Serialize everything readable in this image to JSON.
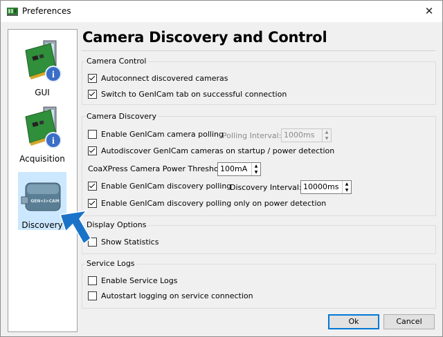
{
  "window": {
    "title": "Preferences",
    "close_icon": "✕"
  },
  "sidebar": {
    "items": [
      {
        "label": "GUI",
        "icon": "pc-card-info-icon"
      },
      {
        "label": "Acquisition",
        "icon": "pc-card-info-icon"
      },
      {
        "label": "Discovery",
        "icon": "genicam-camera-icon",
        "selected": true
      }
    ]
  },
  "page": {
    "heading": "Camera Discovery and Control"
  },
  "camera_control": {
    "title": "Camera Control",
    "autoconnect": {
      "label": "Autoconnect discovered cameras",
      "checked": true
    },
    "switch_tab": {
      "label": "Switch to GenICam tab on successful connection",
      "checked": true
    }
  },
  "camera_discovery": {
    "title": "Camera Discovery",
    "enable_polling": {
      "label": "Enable GenICam camera polling",
      "checked": false
    },
    "polling_interval_label": "Polling Interval:",
    "polling_interval_value": "1000ms",
    "autodiscover": {
      "label": "Autodiscover GenICam cameras on startup / power detection",
      "checked": true
    },
    "power_threshold_label": "CoaXPress Camera Power Threshold:",
    "power_threshold_value": "100mA",
    "enable_discovery_polling": {
      "label": "Enable GenICam discovery polling",
      "checked": true
    },
    "discovery_interval_label": "Discovery Interval:",
    "discovery_interval_value": "10000ms",
    "polling_on_power": {
      "label": "Enable GenICam discovery polling only on power detection",
      "checked": true
    }
  },
  "display_options": {
    "title": "Display Options",
    "show_statistics": {
      "label": "Show Statistics",
      "checked": false
    }
  },
  "service_logs": {
    "title": "Service Logs",
    "enable_logs": {
      "label": "Enable Service Logs",
      "checked": false
    },
    "autostart": {
      "label": "Autostart logging on service connection",
      "checked": false
    }
  },
  "buttons": {
    "ok": "Ok",
    "cancel": "Cancel"
  },
  "colors": {
    "accent": "#0078d7",
    "selection": "#cce8ff",
    "pointer_arrow": "#1a73c8"
  }
}
